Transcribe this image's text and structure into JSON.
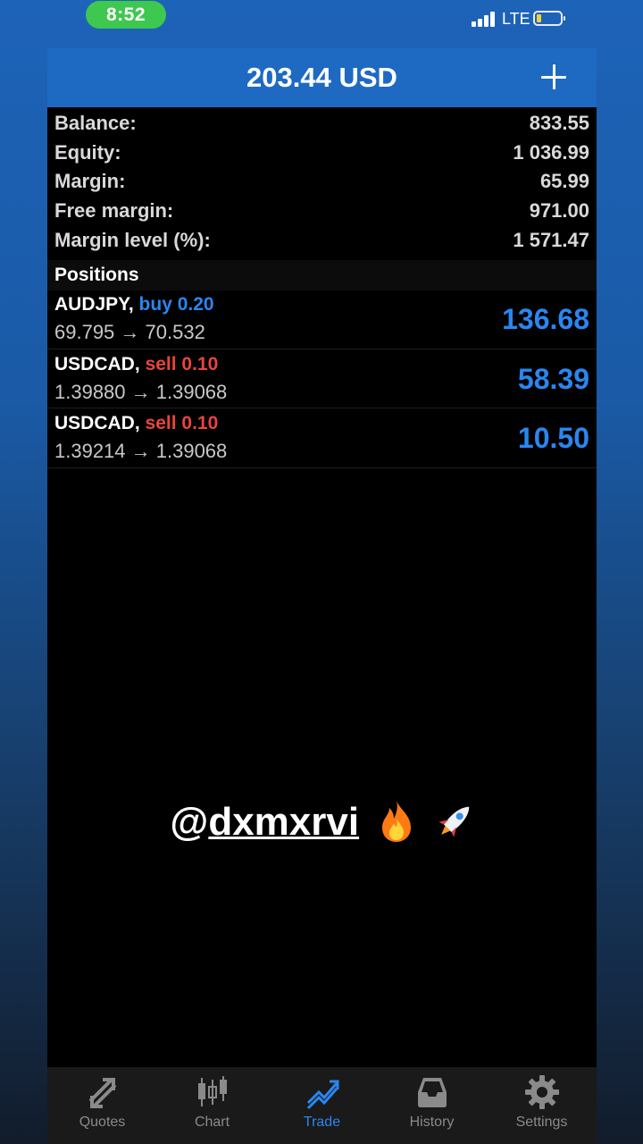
{
  "status_bar": {
    "time": "8:52",
    "network": "LTE"
  },
  "header": {
    "title": "203.44 USD",
    "add_icon": "plus-icon"
  },
  "summary": [
    {
      "label": "Balance:",
      "value": "833.55"
    },
    {
      "label": "Equity:",
      "value": "1 036.99"
    },
    {
      "label": "Margin:",
      "value": "65.99"
    },
    {
      "label": "Free margin:",
      "value": "971.00"
    },
    {
      "label": "Margin level (%):",
      "value": "1 571.47"
    }
  ],
  "positions": {
    "header": "Positions",
    "items": [
      {
        "symbol": "AUDJPY,",
        "direction": "buy",
        "volume": "0.20",
        "prices": "69.795 → 70.532",
        "profit": "136.68"
      },
      {
        "symbol": "USDCAD,",
        "direction": "sell",
        "volume": "0.10",
        "prices": "1.39880 → 1.39068",
        "profit": "58.39"
      },
      {
        "symbol": "USDCAD,",
        "direction": "sell",
        "volume": "0.10",
        "prices": "1.39214 → 1.39068",
        "profit": "10.50"
      }
    ]
  },
  "overlay": {
    "at": "@",
    "handle": "dxmxrvi",
    "emojis": [
      "fire-icon",
      "rocket-icon"
    ]
  },
  "tabbar": {
    "active": "Trade",
    "tabs": [
      {
        "label": "Quotes",
        "icon": "quotes-icon"
      },
      {
        "label": "Chart",
        "icon": "chart-icon"
      },
      {
        "label": "Trade",
        "icon": "trade-icon"
      },
      {
        "label": "History",
        "icon": "history-icon"
      },
      {
        "label": "Settings",
        "icon": "gear-icon"
      }
    ]
  },
  "colors": {
    "accent": "#2a86f0",
    "sell": "#e8453c",
    "header_bg": "#1e6ac2",
    "time_pill": "#3ec84f"
  }
}
